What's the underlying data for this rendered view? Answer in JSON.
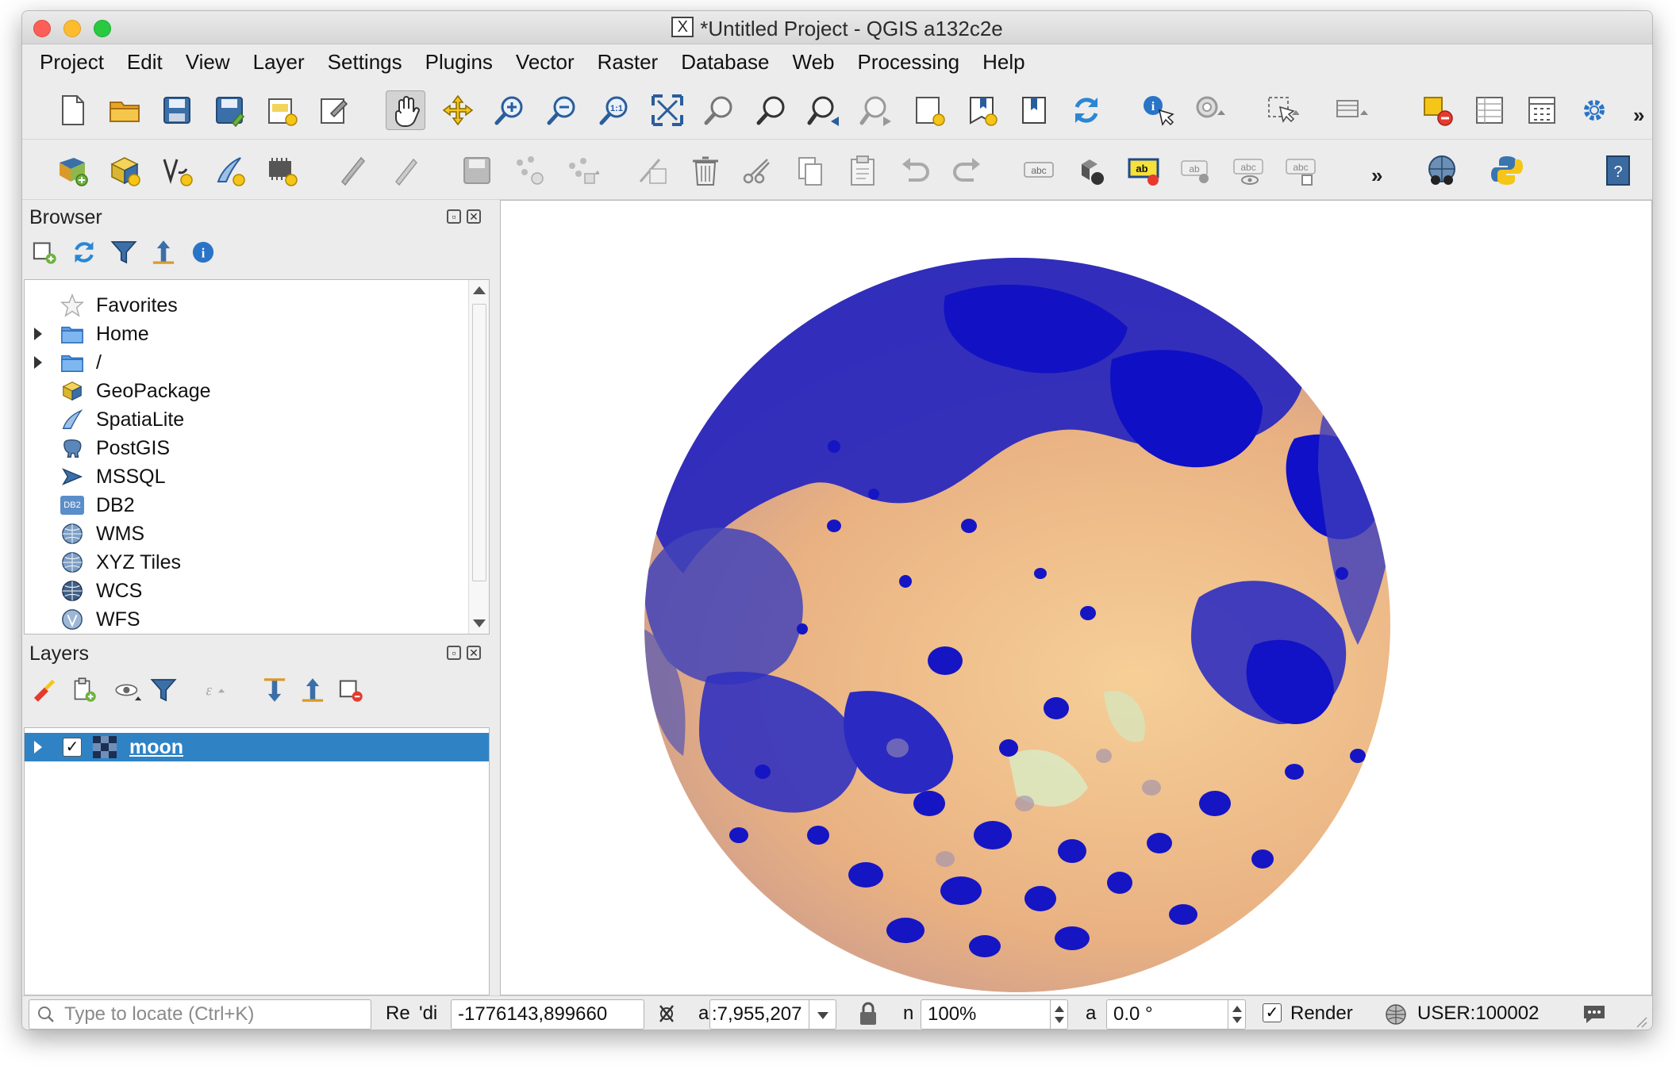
{
  "window": {
    "title": "*Untitled Project - QGIS a132c2e",
    "title_x": "X"
  },
  "menubar": {
    "items": [
      "Project",
      "Edit",
      "View",
      "Layer",
      "Settings",
      "Plugins",
      "Vector",
      "Raster",
      "Database",
      "Web",
      "Processing",
      "Help"
    ]
  },
  "toolbar": {
    "overflow_1": "»",
    "overflow_2": "»",
    "abc": "abc",
    "ab": "ab",
    "one_to_one": "1:1"
  },
  "browser": {
    "title": "Browser",
    "items": [
      {
        "label": "Favorites",
        "icon": "star-icon",
        "expandable": false
      },
      {
        "label": "Home",
        "icon": "folder-icon",
        "expandable": true
      },
      {
        "label": "/",
        "icon": "folder-icon",
        "expandable": true
      },
      {
        "label": "GeoPackage",
        "icon": "geopackage-icon",
        "expandable": false
      },
      {
        "label": "SpatiaLite",
        "icon": "spatialite-icon",
        "expandable": false
      },
      {
        "label": "PostGIS",
        "icon": "postgis-elephant-icon",
        "expandable": false
      },
      {
        "label": "MSSQL",
        "icon": "mssql-icon",
        "expandable": false
      },
      {
        "label": "DB2",
        "icon": "db2-icon",
        "expandable": false
      },
      {
        "label": "WMS",
        "icon": "globe-icon",
        "expandable": false
      },
      {
        "label": "XYZ Tiles",
        "icon": "globe-icon",
        "expandable": false
      },
      {
        "label": "WCS",
        "icon": "globe-icon",
        "expandable": false
      },
      {
        "label": "WFS",
        "icon": "globe-icon",
        "expandable": false
      }
    ],
    "db2_badge": "DB2"
  },
  "layers": {
    "title": "Layers",
    "items": [
      {
        "label": "moon",
        "checked": true,
        "selected": true
      }
    ],
    "check_mark": "✓"
  },
  "statusbar": {
    "search_placeholder": "Type to locate (Ctrl+K)",
    "coordinate_label": "Re",
    "coordinate_sub_label": "'di",
    "coordinate_value": "-1776143,899660",
    "scale_label": "a",
    "scale_value": ":7,955,207",
    "magnifier_label": "n",
    "magnifier_value": "100%",
    "rotation_label": "a",
    "rotation_value": "0.0 °",
    "render_label": "Render",
    "render_checked": true,
    "render_check_mark": "✓",
    "crs_label": "USER:100002"
  },
  "colors": {
    "selection": "#2f83c5",
    "moon_dark": "#1a1ab8",
    "moon_light": "#f2c48a",
    "moon_pale": "#d9ecc5"
  }
}
